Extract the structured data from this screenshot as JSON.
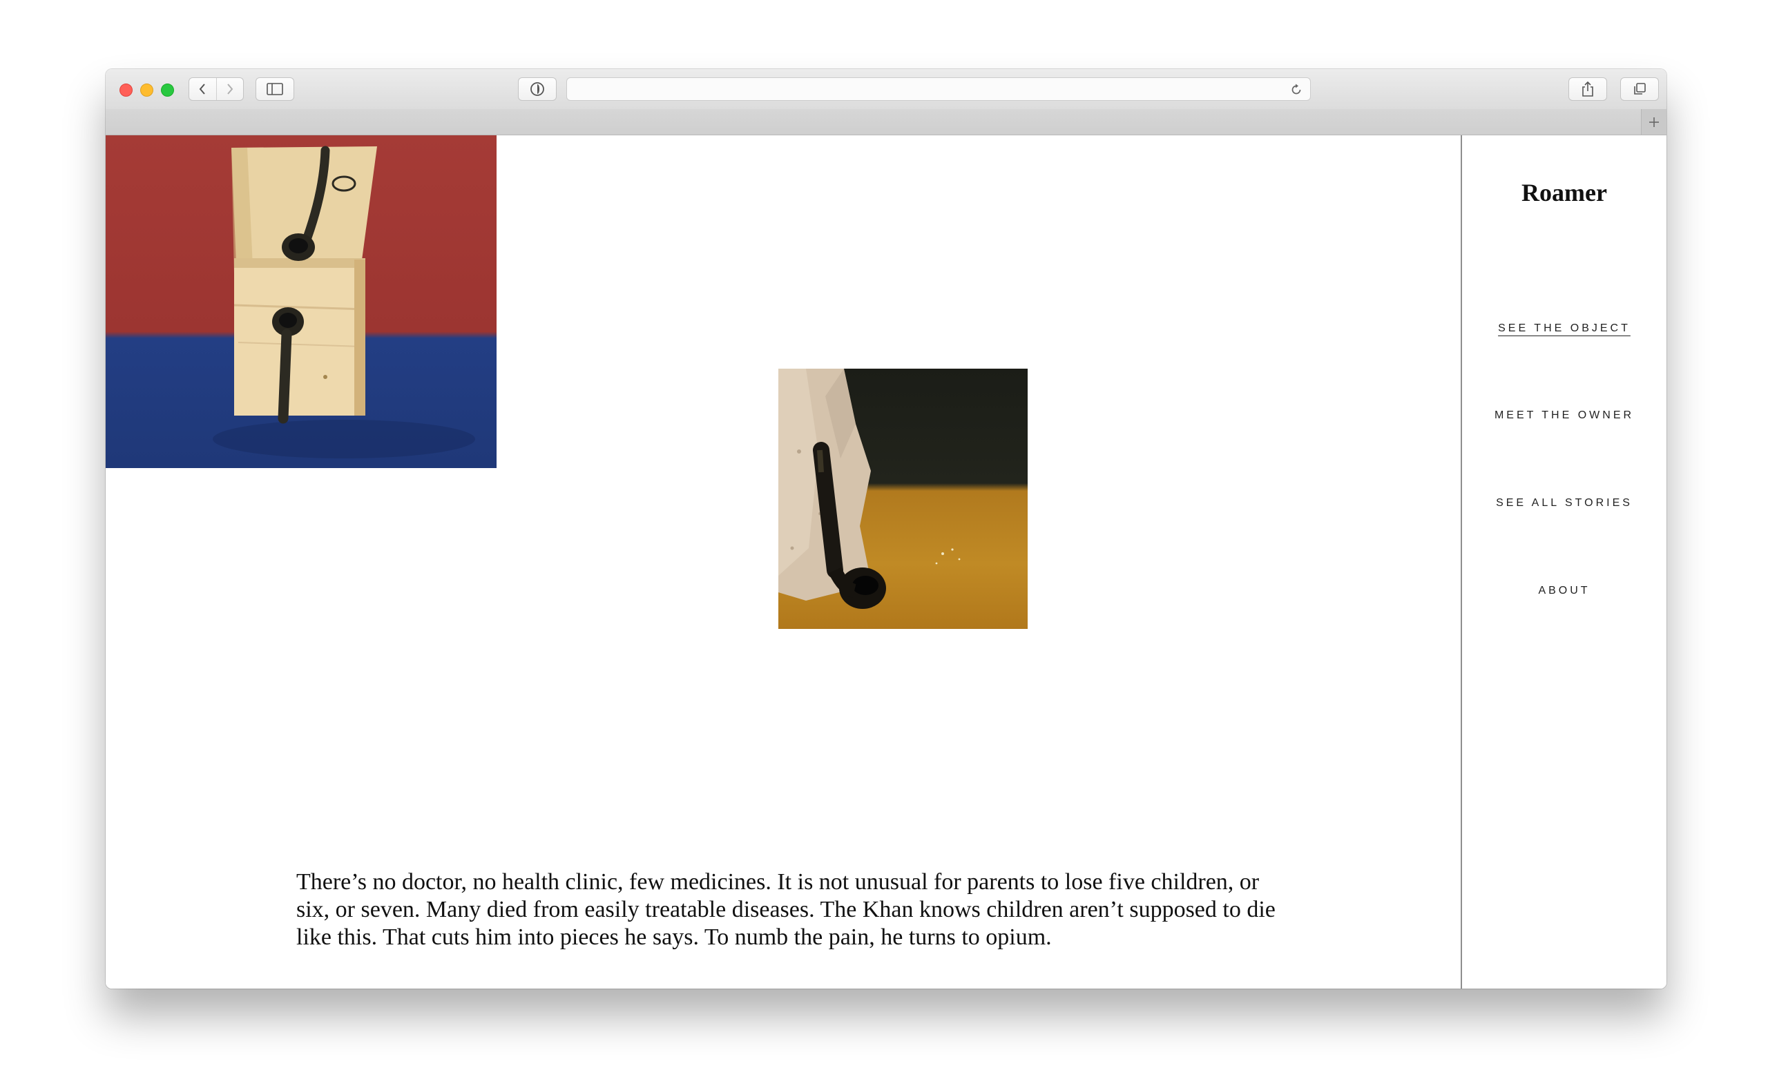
{
  "browser": {
    "url": "",
    "icons": {
      "back": "chevron-left-icon",
      "forward": "chevron-right-icon",
      "sidebar": "sidebar-icon",
      "privacy": "shield-icon",
      "reload": "reload-icon",
      "share": "share-icon",
      "tabs": "tabs-overview-icon",
      "new_tab": "plus-icon"
    }
  },
  "site": {
    "logo": "Roamer",
    "nav": [
      {
        "label": "SEE THE OBJECT",
        "active": true
      },
      {
        "label": "MEET THE OWNER",
        "active": false
      },
      {
        "label": "SEE ALL STORIES",
        "active": false
      },
      {
        "label": "ABOUT",
        "active": false
      }
    ]
  },
  "article": {
    "body": "There’s no doctor, no health clinic, few medicines. It is not unusual for parents to lose five children, or six, or seven. Many died from easily treatable diseases.  The Khan knows children aren’t supposed to die like this. That cuts him into pieces he says. To numb the pain, he turns to opium."
  },
  "colors": {
    "accent_text": "#111111",
    "photo1_wall": "#a53b36",
    "photo1_floor": "#233e84",
    "photo2_background": "#1b1d17",
    "photo2_floor": "#c08a25"
  }
}
